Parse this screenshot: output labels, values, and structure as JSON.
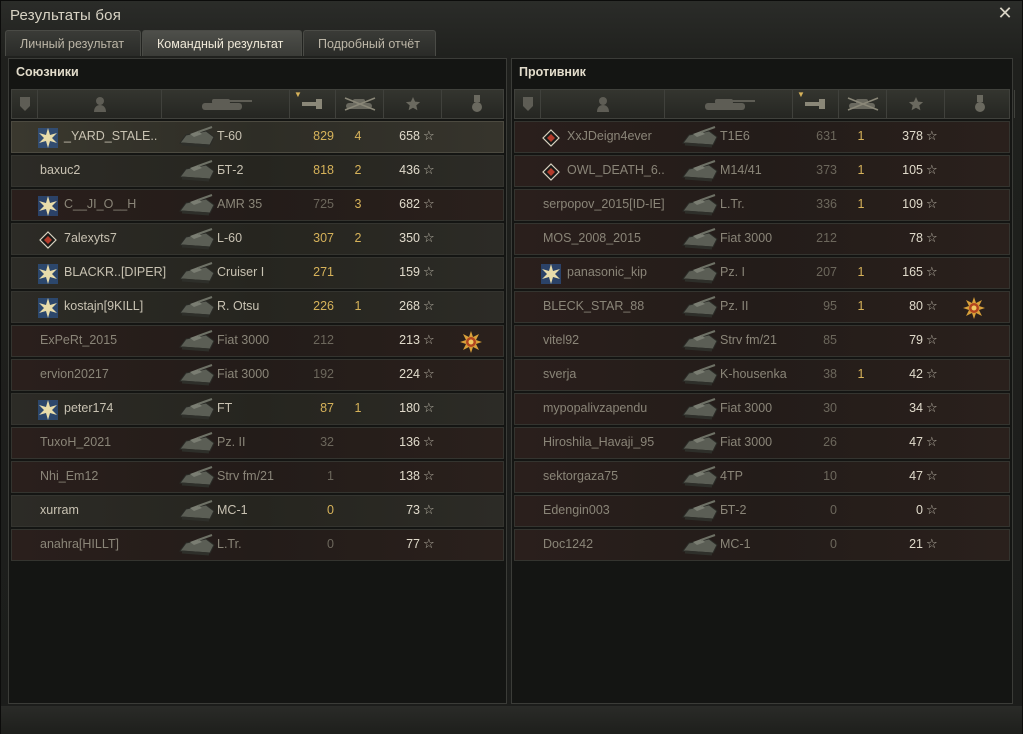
{
  "window": {
    "title": "Результаты боя",
    "close_glyph": "✕"
  },
  "tabs": [
    {
      "label": "Личный результат",
      "active": false
    },
    {
      "label": "Командный результат",
      "active": true
    },
    {
      "label": "Подробный отчёт",
      "active": false
    }
  ],
  "allies": {
    "title": "Союзники",
    "rows": [
      {
        "player": "_YARD_STALE..",
        "badge": "star-badge-icon",
        "tank": "T-60",
        "damage": "829",
        "kills": "4",
        "xp": "658",
        "state": "self",
        "medal": ""
      },
      {
        "player": "baxuc2",
        "badge": "",
        "tank": "БТ-2",
        "damage": "818",
        "kills": "2",
        "xp": "436",
        "state": "alive",
        "medal": ""
      },
      {
        "player": "C__JI_O__H",
        "badge": "star-badge-icon",
        "tank": "AMR 35",
        "damage": "725",
        "kills": "3",
        "xp": "682",
        "state": "dead",
        "medal": ""
      },
      {
        "player": "7alexyts7",
        "badge": "diamond-badge-icon",
        "tank": "L-60",
        "damage": "307",
        "kills": "2",
        "xp": "350",
        "state": "alive",
        "medal": ""
      },
      {
        "player": "BLACKR..[DIPER]",
        "badge": "star-badge-icon",
        "tank": "Cruiser I",
        "damage": "271",
        "kills": "",
        "xp": "159",
        "state": "alive",
        "medal": ""
      },
      {
        "player": "kostajn[9KILL]",
        "badge": "star-badge-icon",
        "tank": "R. Otsu",
        "damage": "226",
        "kills": "1",
        "xp": "268",
        "state": "alive",
        "medal": ""
      },
      {
        "player": "ExPeRt_2015",
        "badge": "",
        "tank": "Fiat 3000",
        "damage": "212",
        "kills": "",
        "xp": "213",
        "state": "dead",
        "medal": "medal-icon"
      },
      {
        "player": "ervion20217",
        "badge": "",
        "tank": "Fiat 3000",
        "damage": "192",
        "kills": "",
        "xp": "224",
        "state": "dead",
        "medal": ""
      },
      {
        "player": "peter174",
        "badge": "star-badge-icon",
        "tank": "FT",
        "damage": "87",
        "kills": "1",
        "xp": "180",
        "state": "alive",
        "medal": ""
      },
      {
        "player": "TuxoH_2021",
        "badge": "",
        "tank": "Pz. II",
        "damage": "32",
        "kills": "",
        "xp": "136",
        "state": "dead",
        "medal": ""
      },
      {
        "player": "Nhi_Em12",
        "badge": "",
        "tank": "Strv fm/21",
        "damage": "1",
        "kills": "",
        "xp": "138",
        "state": "dead",
        "medal": ""
      },
      {
        "player": "xurram",
        "badge": "",
        "tank": "MC-1",
        "damage": "0",
        "kills": "",
        "xp": "73",
        "state": "alive",
        "medal": ""
      },
      {
        "player": "anahra[HILLT]",
        "badge": "",
        "tank": "L.Tr.",
        "damage": "0",
        "kills": "",
        "xp": "77",
        "state": "dead",
        "medal": ""
      }
    ]
  },
  "enemies": {
    "title": "Противник",
    "rows": [
      {
        "player": "XxJDeign4ever",
        "badge": "diamond-badge-icon",
        "tank": "T1E6",
        "damage": "631",
        "kills": "1",
        "xp": "378",
        "state": "dead",
        "medal": ""
      },
      {
        "player": "OWL_DEATH_6..",
        "badge": "diamond-badge-icon",
        "tank": "M14/41",
        "damage": "373",
        "kills": "1",
        "xp": "105",
        "state": "dead",
        "medal": ""
      },
      {
        "player": "serpopov_2015[ID-IE]",
        "badge": "",
        "tank": "L.Tr.",
        "damage": "336",
        "kills": "1",
        "xp": "109",
        "state": "dead",
        "medal": ""
      },
      {
        "player": "MOS_2008_2015",
        "badge": "",
        "tank": "Fiat 3000",
        "damage": "212",
        "kills": "",
        "xp": "78",
        "state": "dead",
        "medal": ""
      },
      {
        "player": "panasonic_kip",
        "badge": "star-badge-icon",
        "tank": "Pz. I",
        "damage": "207",
        "kills": "1",
        "xp": "165",
        "state": "dead",
        "medal": ""
      },
      {
        "player": "BLECK_STAR_88",
        "badge": "",
        "tank": "Pz. II",
        "damage": "95",
        "kills": "1",
        "xp": "80",
        "state": "dead",
        "medal": "medal-icon"
      },
      {
        "player": "vitel92",
        "badge": "",
        "tank": "Strv fm/21",
        "damage": "85",
        "kills": "",
        "xp": "79",
        "state": "dead",
        "medal": ""
      },
      {
        "player": "sverja",
        "badge": "",
        "tank": "K-housenka",
        "damage": "38",
        "kills": "1",
        "xp": "42",
        "state": "dead",
        "medal": ""
      },
      {
        "player": "mypopalivzapendu",
        "badge": "",
        "tank": "Fiat 3000",
        "damage": "30",
        "kills": "",
        "xp": "34",
        "state": "dead",
        "medal": ""
      },
      {
        "player": "Hiroshila_Havaji_95",
        "badge": "",
        "tank": "Fiat 3000",
        "damage": "26",
        "kills": "",
        "xp": "47",
        "state": "dead",
        "medal": ""
      },
      {
        "player": "sektorgaza75",
        "badge": "",
        "tank": "4TP",
        "damage": "10",
        "kills": "",
        "xp": "47",
        "state": "dead",
        "medal": ""
      },
      {
        "player": "Edengin003",
        "badge": "",
        "tank": "БТ-2",
        "damage": "0",
        "kills": "",
        "xp": "0",
        "state": "dead",
        "medal": ""
      },
      {
        "player": "Doc1242",
        "badge": "",
        "tank": "MC-1",
        "damage": "0",
        "kills": "",
        "xp": "21",
        "state": "dead",
        "medal": ""
      }
    ]
  },
  "columns": [
    {
      "icon": "squad-icon"
    },
    {
      "icon": "player-icon"
    },
    {
      "icon": "tank-icon"
    },
    {
      "icon": "damage-icon",
      "sorted": true
    },
    {
      "icon": "kills-icon"
    },
    {
      "icon": "xp-star-icon"
    },
    {
      "icon": "medal-column-icon"
    }
  ],
  "star_glyph": "☆",
  "colors": {
    "gold": "#d6b25a",
    "text": "#c8c2b2"
  }
}
